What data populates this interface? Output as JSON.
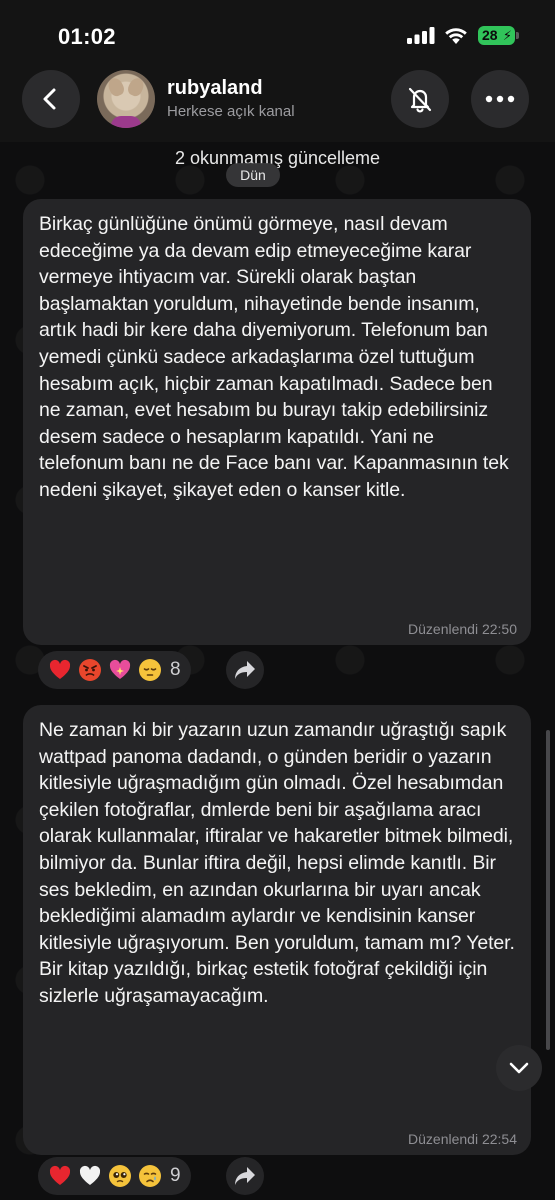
{
  "status_bar": {
    "time": "01:02",
    "battery": "28"
  },
  "header": {
    "channel_name": "rubyaland",
    "subtitle": "Herkese açık kanal"
  },
  "banner": {
    "unread": "2 okunmamış güncelleme",
    "date": "Dün"
  },
  "messages": [
    {
      "text": "Birkaç günlüğüne önümü görmeye, nasıl devam edeceğime ya da devam edip etmeyeceğime karar vermeye ihtiyacım var. Sürekli olarak baştan başlamaktan yoruldum, nihayetinde bende insanım, artık hadi bir kere daha diyemiyorum. Telefonum ban yemedi çünkü sadece arkadaşlarıma özel tuttuğum hesabım açık, hiçbir zaman kapatılmadı. Sadece ben ne zaman, evet hesabım bu burayı takip edebilirsiniz desem sadece o hesaplarım kapatıldı. Yani ne telefonum banı ne de Face banı var. Kapanmasının tek nedeni şikayet, şikayet eden o kanser kitle.",
      "meta": "Düzenlendi 22:50",
      "reactions": [
        "red-heart",
        "angry-face",
        "sparkling-heart",
        "pensive-face"
      ],
      "reaction_count": "8"
    },
    {
      "text": "Ne zaman ki bir yazarın uzun zamandır uğraştığı sapık wattpad panoma dadandı, o günden beridir o yazarın kitlesiyle uğraşmadığım gün olmadı. Özel hesabımdan çekilen fotoğraflar, dmlerde beni bir aşağılama aracı olarak kullanmalar, iftiralar ve hakaretler bitmek bilmedi, bilmiyor da. Bunlar iftira değil, hepsi elimde kanıtlı. Bir ses bekledim, en azından okurlarına bir uyarı ancak beklediğimi alamadım aylardır ve kendisinin kanser kitlesiyle uğraşıyorum. Ben yoruldum, tamam mı? Yeter. Bir kitap yazıldığı, birkaç estetik fotoğraf çekildiği için sizlerle uğraşamayacağım.",
      "meta": "Düzenlendi 22:54",
      "reactions": [
        "red-heart",
        "white-heart",
        "pleading-face",
        "crying-face"
      ],
      "reaction_count": "9"
    }
  ],
  "colors": {
    "background": "#0b0b0c",
    "bubble": "#252527",
    "accent_battery": "#31c45a",
    "meta_text": "#8e8e93"
  }
}
